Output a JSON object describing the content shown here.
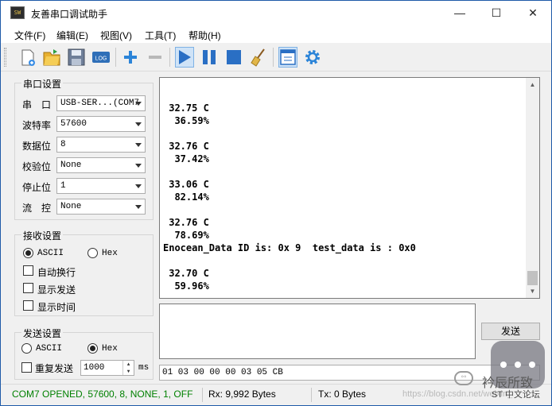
{
  "window": {
    "title": "友善串口调试助手",
    "app_icon_text": "SW",
    "controls": {
      "minimize": "—",
      "maximize": "☐",
      "close": "✕"
    }
  },
  "menu": [
    "文件(F)",
    "编辑(E)",
    "视图(V)",
    "工具(T)",
    "帮助(H)"
  ],
  "toolbar": {
    "log_label": "LOG",
    "icons": [
      "new-file-icon",
      "open-folder-icon",
      "save-icon",
      "log-icon",
      "plus-icon",
      "minus-icon",
      "play-icon",
      "pause-icon",
      "stop-icon",
      "broom-icon",
      "window-icon",
      "gear-icon"
    ]
  },
  "serial_settings": {
    "title": "串口设置",
    "rows": [
      {
        "label": "串　口",
        "value": "USB-SER...(COM7"
      },
      {
        "label": "波特率",
        "value": "57600"
      },
      {
        "label": "数据位",
        "value": "8"
      },
      {
        "label": "校验位",
        "value": "None"
      },
      {
        "label": "停止位",
        "value": "1"
      },
      {
        "label": "流　控",
        "value": "None"
      }
    ]
  },
  "receive_settings": {
    "title": "接收设置",
    "ascii_label": "ASCII",
    "hex_label": "Hex",
    "selected": "ASCII",
    "auto_wrap": "自动换行",
    "show_send": "显示发送",
    "show_time": "显示时间"
  },
  "send_settings": {
    "title": "发送设置",
    "ascii_label": "ASCII",
    "hex_label": "Hex",
    "selected": "Hex",
    "repeat_label": "重复发送",
    "interval": "1000",
    "unit": "ms"
  },
  "receive_log": [
    "",
    " 32.75 C",
    "  36.59%",
    "",
    " 32.76 C",
    "  37.42%",
    "",
    " 33.06 C",
    "  82.14%",
    "",
    " 32.76 C",
    "  78.69%",
    "Enocean_Data ID is: 0x 9  test_data is : 0x0",
    "",
    " 32.70 C",
    "  59.96%"
  ],
  "send": {
    "text": "",
    "button": "发送",
    "history": "01 03 00 00 00 03 05 CB"
  },
  "status": {
    "port": "COM7 OPENED, 57600, 8, NONE, 1, OFF",
    "rx": "Rx: 9,992 Bytes",
    "tx": "Tx: 0 Bytes",
    "port_color": "#008000"
  },
  "watermark": {
    "url": "https://blog.csdn.net/weixin_",
    "name": "衿辰所致",
    "forum": "ST 中文论坛"
  }
}
